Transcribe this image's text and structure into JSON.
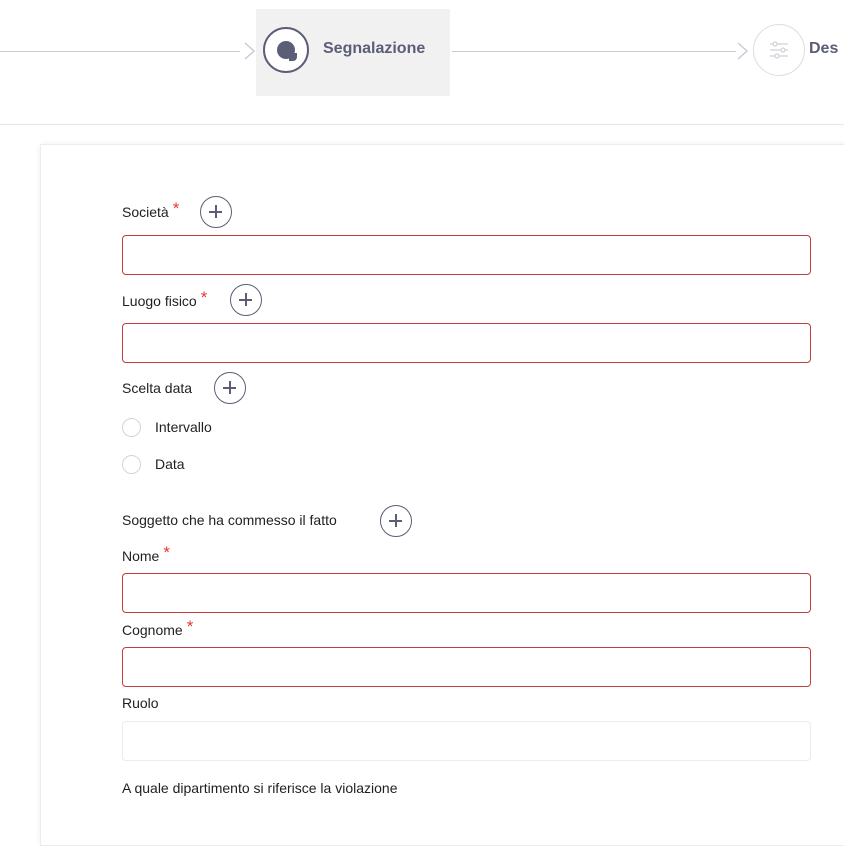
{
  "stepper": {
    "steps": [
      {
        "label": "Segnalazione",
        "state": "active",
        "icon": "chat-bubble-icon"
      },
      {
        "label": "Des",
        "state": "upcoming",
        "icon": "sliders-icon"
      }
    ]
  },
  "form": {
    "societa_label": "Società",
    "luogo_label": "Luogo fisico",
    "scelta_data_label": "Scelta data",
    "radio_options": [
      "Intervallo",
      "Data"
    ],
    "soggetto_label": "Soggetto che ha commesso il fatto",
    "nome_label": "Nome",
    "cognome_label": "Cognome",
    "ruolo_label": "Ruolo",
    "dipartimento_label": "A quale dipartimento si riferisce la violazione",
    "required_mark": "*"
  },
  "colors": {
    "accent": "#5b5e76",
    "error": "#c43b3b",
    "required": "#e53935"
  }
}
